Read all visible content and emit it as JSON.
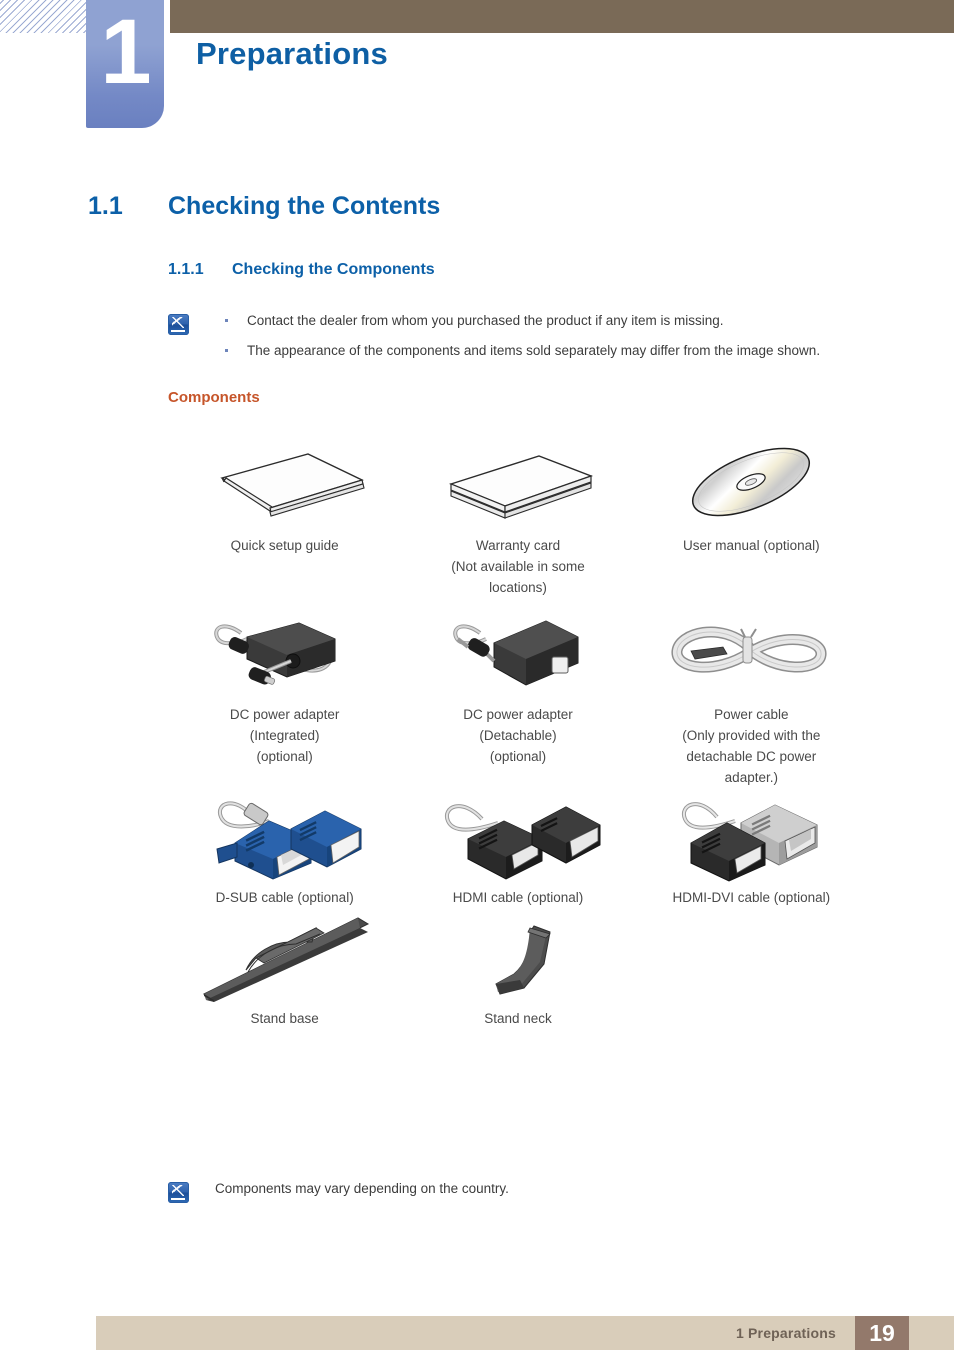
{
  "chapter": {
    "number": "1",
    "title": "Preparations"
  },
  "section": {
    "number": "1.1",
    "title": "Checking the Contents"
  },
  "subsection": {
    "number": "1.1.1",
    "title": "Checking the Components"
  },
  "note_top": {
    "icon": "note-pencil-icon",
    "bullets": [
      "Contact the dealer from whom you purchased the product if any item is missing.",
      "The appearance of the components and items sold separately may differ from the image shown."
    ]
  },
  "components_label": "Components",
  "components": {
    "rows": [
      {
        "cells": [
          {
            "art": "booklet-icon",
            "caption_lines": [
              "Quick setup guide"
            ]
          },
          {
            "art": "card-stack-icon",
            "caption_lines": [
              "Warranty card",
              "(Not available in some",
              "locations)"
            ]
          },
          {
            "art": "cd-disc-icon",
            "caption_lines": [
              "User manual (optional)"
            ]
          }
        ]
      },
      {
        "cells": [
          {
            "art": "dc-adapter-integrated-icon",
            "caption_lines": [
              "DC power adapter",
              "(Integrated)",
              "(optional)"
            ]
          },
          {
            "art": "dc-adapter-detachable-icon",
            "caption_lines": [
              "DC power adapter",
              "(Detachable)",
              "(optional)"
            ]
          },
          {
            "art": "power-cable-icon",
            "caption_lines": [
              "Power cable",
              "(Only provided with the",
              "detachable DC power",
              "adapter.)"
            ]
          }
        ]
      },
      {
        "cells": [
          {
            "art": "dsub-cable-icon",
            "caption_lines": [
              "D-SUB cable (optional)"
            ]
          },
          {
            "art": "hdmi-cable-icon",
            "caption_lines": [
              "HDMI cable (optional)"
            ]
          },
          {
            "art": "hdmi-dvi-cable-icon",
            "caption_lines": [
              "HDMI-DVI cable (optional)"
            ]
          }
        ]
      },
      {
        "cells": [
          {
            "art": "stand-base-icon",
            "caption_lines": [
              "Stand base"
            ]
          },
          {
            "art": "stand-neck-icon",
            "caption_lines": [
              "Stand neck"
            ]
          },
          {
            "art": "",
            "caption_lines": []
          }
        ]
      }
    ]
  },
  "note_bottom": {
    "icon": "note-pencil-icon",
    "text": "Components may vary depending on the country."
  },
  "footer": {
    "text": "1 Preparations",
    "page": "19"
  },
  "colors": {
    "heading_blue": "#0c60a8",
    "chapter_blue": "#0e5fa4",
    "chapter_tab": "#7489c6",
    "header_bar": "#7a6a57",
    "components_orange": "#c6552a",
    "footer_bar": "#d9cdba",
    "footer_page": "#93796b"
  }
}
